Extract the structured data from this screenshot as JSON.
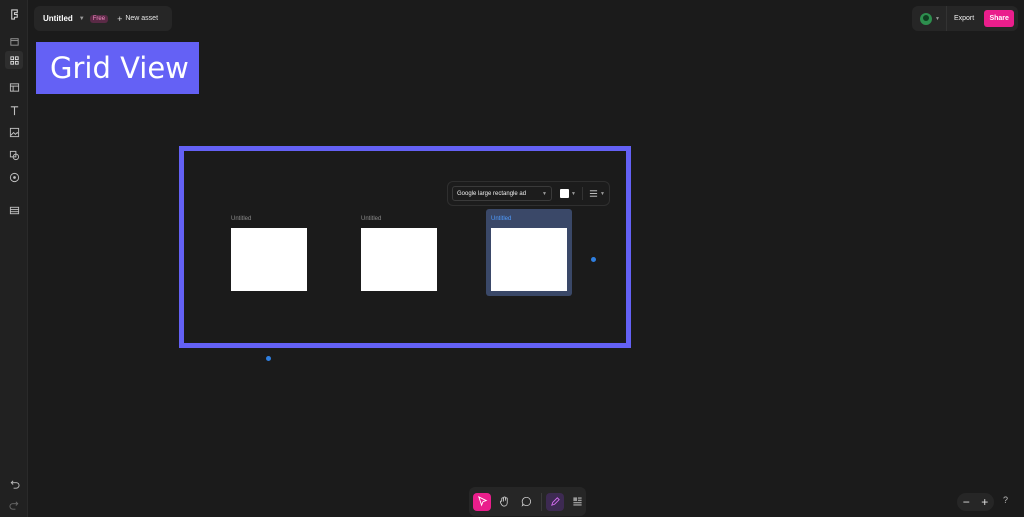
{
  "header": {
    "doc_title": "Untitled",
    "plan_badge": "Free",
    "new_asset_label": "New asset",
    "export_label": "Export",
    "share_label": "Share"
  },
  "banner": {
    "text": "Grid View"
  },
  "context_toolbar": {
    "size_preset": "Google large rectangle ad",
    "fill_color": "#ffffff"
  },
  "artboards": [
    {
      "label": "Untitled",
      "selected": false
    },
    {
      "label": "Untitled",
      "selected": false
    },
    {
      "label": "Untitled",
      "selected": true
    }
  ],
  "sidebar": {
    "icons": [
      "logo-icon",
      "pages-icon",
      "grid-view-icon",
      "layout-icon",
      "text-icon",
      "image-icon",
      "shapes-icon",
      "plugins-icon",
      "data-icon",
      "undo-icon",
      "redo-icon"
    ]
  },
  "bottom_toolbar": {
    "tools": [
      "select-tool",
      "hand-tool",
      "comment-tool",
      "pen-tool",
      "grid-tool"
    ]
  },
  "zoom": {
    "minus": "−",
    "plus": "+"
  },
  "help_label": "?",
  "colors": {
    "accent": "#6461f5",
    "share": "#ea1e8c",
    "canvas": "#1b1b1b",
    "selection_blue": "#2f7fe0"
  }
}
